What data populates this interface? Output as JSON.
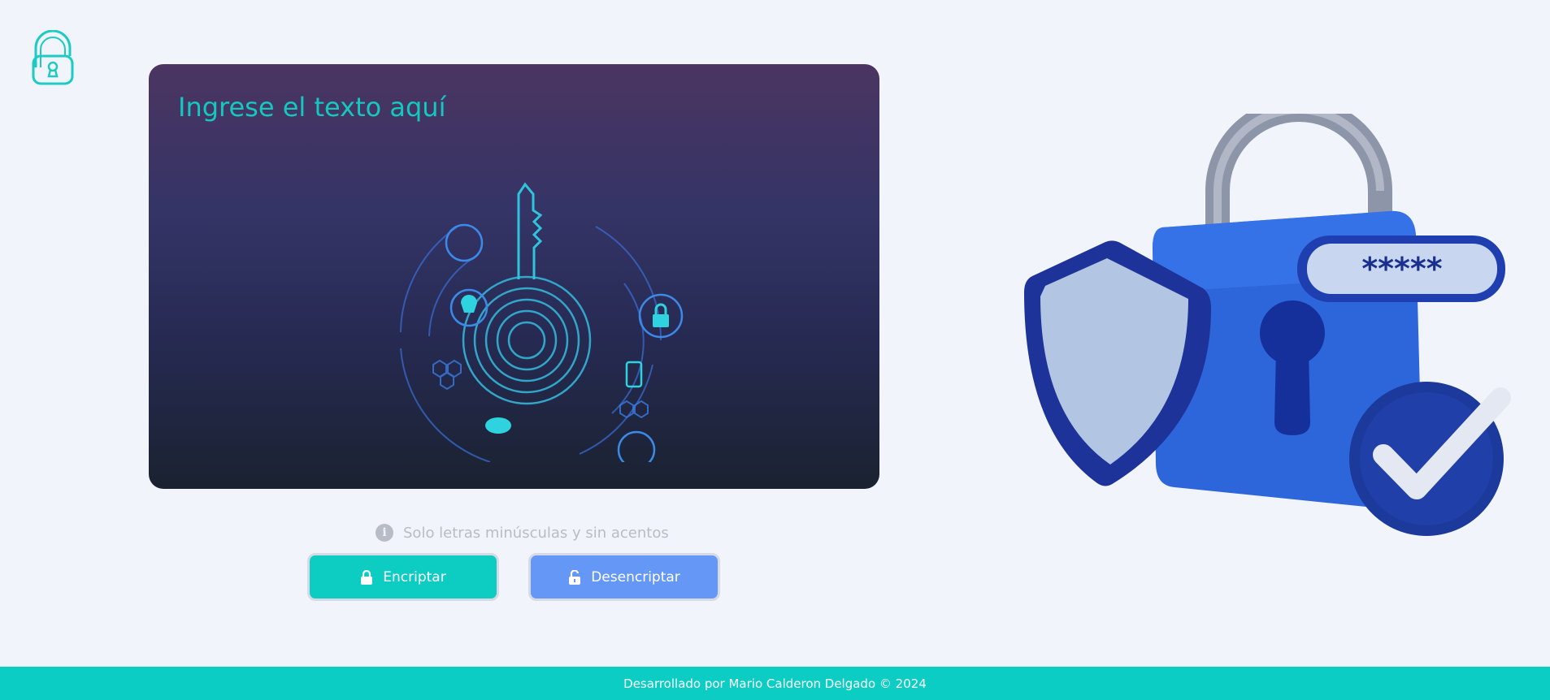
{
  "header": {
    "logo_icon": "open-padlock-letter-a-icon"
  },
  "editor": {
    "placeholder": "Ingrese el texto aquí",
    "value": ""
  },
  "hint": {
    "icon": "info-icon",
    "text": "Solo letras minúsculas y sin acentos"
  },
  "buttons": {
    "encrypt_label": "Encriptar",
    "encrypt_icon": "lock-icon",
    "decrypt_label": "Desencriptar",
    "decrypt_icon": "unlock-icon"
  },
  "illustration": {
    "masked_text": "*****",
    "icon": "padlock-shield-check-illustration"
  },
  "footer": {
    "text": "Desarrollado por Mario Calderon Delgado © 2024"
  },
  "colors": {
    "accent": "#0bcdc3",
    "secondary": "#6497f6",
    "background": "#f1f4fb"
  }
}
